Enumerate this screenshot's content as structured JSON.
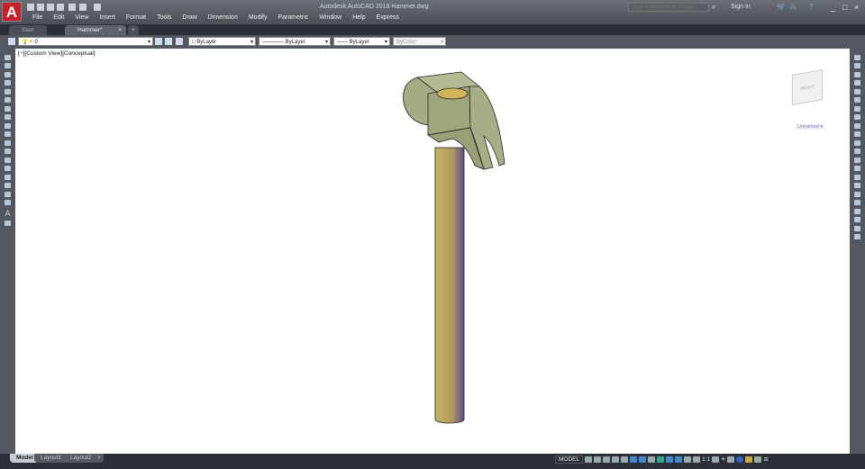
{
  "app": {
    "title": "Autodesk AutoCAD 2018   Hammer.dwg",
    "logo": "A"
  },
  "menu": [
    "File",
    "Edit",
    "View",
    "Insert",
    "Format",
    "Tools",
    "Draw",
    "Dimension",
    "Modify",
    "Parametric",
    "Window",
    "Help",
    "Express"
  ],
  "search": {
    "placeholder": "Type a keyword or phrase"
  },
  "signin": "Sign In",
  "tabs": [
    {
      "label": "Start"
    },
    {
      "label": "Hammer*",
      "active": true
    }
  ],
  "tab_add": "+",
  "properties": {
    "layer": "0",
    "color": "ByLayer",
    "linetype": "———— ByLayer",
    "lineweight": "—— ByLayer",
    "plotstyle": "ByColor"
  },
  "viewport": {
    "label": "[−][Custom View][Conceptual]",
    "viewcube_face": "RIGHT",
    "ucs": "Unnamed"
  },
  "layout_tabs": [
    "Model",
    "Layout1",
    "Layout2"
  ],
  "layout_add": "+",
  "status": {
    "model": "MODEL",
    "scale": "1:1"
  },
  "colors": {
    "accent": "#c8202a",
    "hammer_head": "#a9ad86",
    "handle": "#c8b463"
  }
}
